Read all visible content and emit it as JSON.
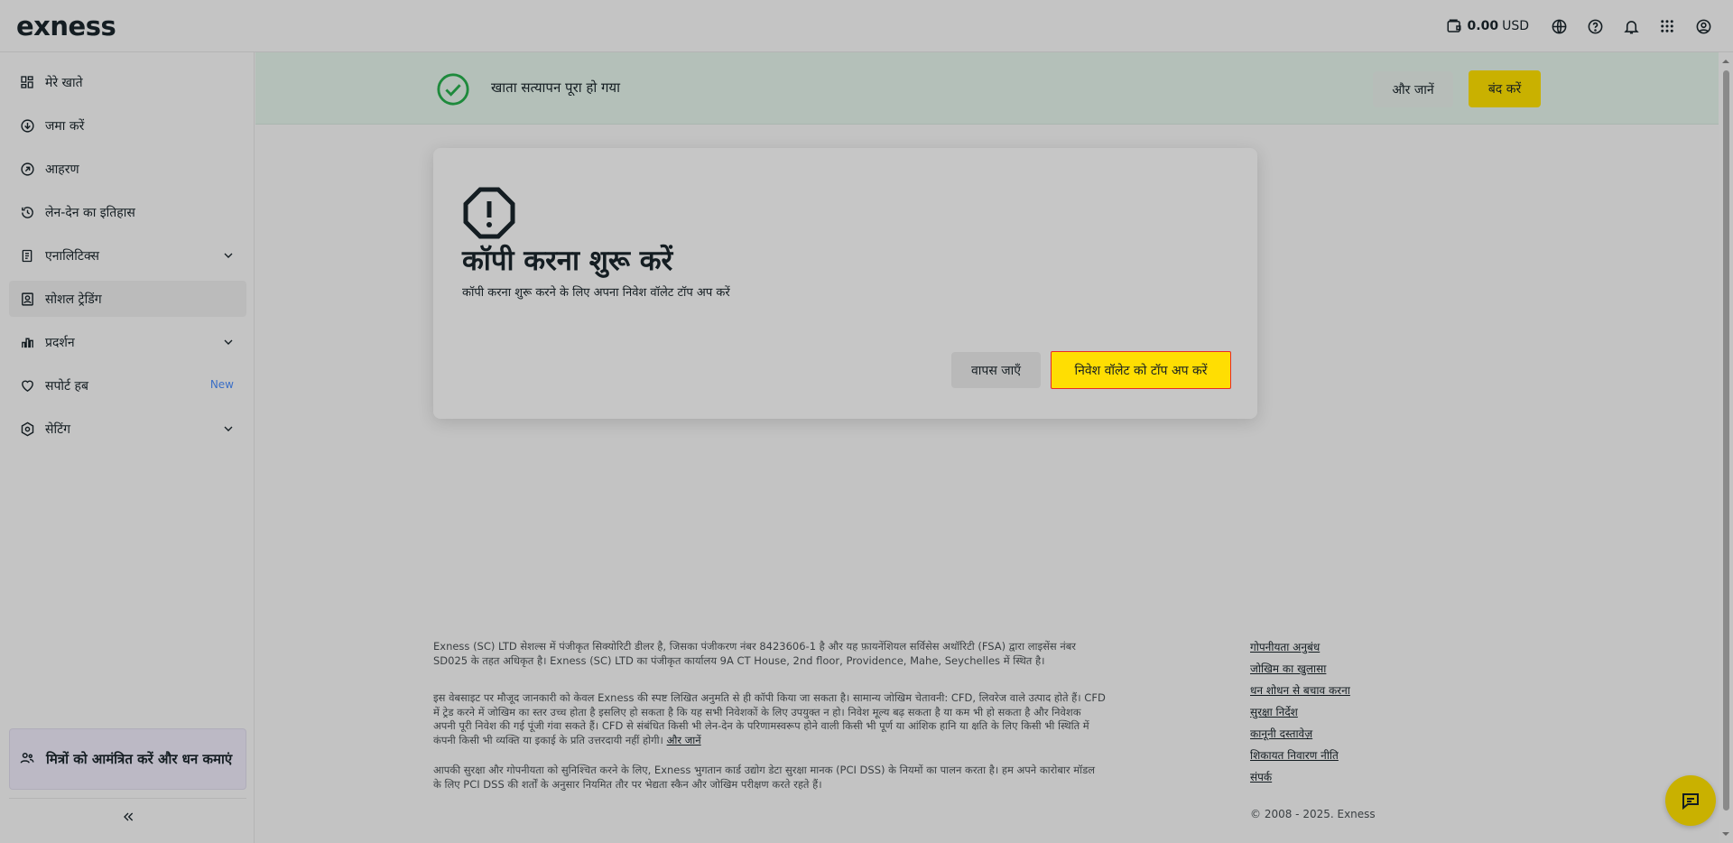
{
  "header": {
    "logo": "exness",
    "balance_amount": "0.00",
    "balance_currency": "USD",
    "icons": [
      "wallet-icon",
      "globe-icon",
      "help-icon",
      "bell-icon",
      "apps-grid-icon",
      "profile-icon"
    ]
  },
  "sidebar": {
    "items": [
      {
        "label": "मेरे खाते",
        "icon": "accounts-grid-icon"
      },
      {
        "label": "जमा करें",
        "icon": "deposit-icon"
      },
      {
        "label": "आहरण",
        "icon": "withdraw-icon"
      },
      {
        "label": "लेन-देन का इतिहास",
        "icon": "history-icon"
      },
      {
        "label": "एनालिटिक्स",
        "icon": "analytics-icon"
      },
      {
        "label": "सोशल ट्रेडिंग",
        "icon": "social-trading-icon"
      },
      {
        "label": "प्रदर्शन",
        "icon": "performance-icon"
      },
      {
        "label": "सपोर्ट हब",
        "icon": "heart-icon",
        "badge": "New"
      },
      {
        "label": "सेटिंग",
        "icon": "settings-icon"
      }
    ],
    "invite": "मित्रों को आमंत्रित करें और धन कमाएं"
  },
  "banner": {
    "message": "खाता सत्यापन पूरा हो गया",
    "learn_more": "और जानें",
    "close": "बंद करें"
  },
  "modal": {
    "title": "कॉपी करना शुरू करें",
    "subtitle": "कॉपी करना शुरू करने के लिए अपना निवेश वॉलेट टॉप अप करें",
    "back": "वापस जाएँ",
    "topup": "निवेश वॉलेट को टॉप अप करें"
  },
  "footer": {
    "legal1": "Exness (SC) LTD सेशल्स में पंजीकृत सिक्योरिटी डीलर है, जिसका पंजीकरण नंबर 8423606-1 है और यह फ़ायनेंशियल सर्विसेस अथॉरिटी (FSA) द्वारा लाइसेंस नंबर SD025 के तहत अधिकृत है। Exness (SC) LTD का पंजीकृत कार्यालय 9A CT House, 2nd floor, Providence, Mahe, Seychelles में स्थित है।",
    "legal2": "इस वेबसाइट पर मौजूद जानकारी को केवल Exness की स्पष्ट लिखित अनुमति से ही कॉपी किया जा सकता है। सामान्य जोखिम चेतावनी: CFD, लिवरेज वाले उत्पाद होते हैं। CFD में ट्रेड करने में जोखिम का स्तर उच्च होता है इसलिए हो सकता है कि यह सभी निवेशकों के लिए उपयुक्त न हो। निवेश मूल्य बढ़ सकता है या कम भी हो सकता है और निवेशक अपनी पूरी निवेश की गई पूंजी गंवा सकते हैं। CFD से संबंधित किसी भी लेन-देन के परिणामस्वरूप होने वाली किसी भी पूर्ण या आंशिक हानि या क्षति के लिए किसी भी स्थिति में कंपनी किसी भी व्यक्ति या इकाई के प्रति उत्तरदायी नहीं होगी।",
    "legal2_more": "और जानें",
    "legal3": "आपकी सुरक्षा और गोपनीयता को सुनिश्चित करने के लिए, Exness भुगतान कार्ड उद्योग डेटा सुरक्षा मानक (PCI DSS) के नियमों का पालन करता है। हम अपने कारोबार मॉडल के लिए PCI DSS की शर्तों के अनुसार नियमित तौर पर भेद्यता स्कैन और जोखिम परीक्षण करते रहते हैं।",
    "links": [
      "गोपनीयता अनुबंध",
      "जोखिम का खुलासा",
      "धन शोधन से बचाव करना",
      "सुरक्षा निर्देश",
      "कानूनी दस्तावेज़",
      "शिकायत निवारण नीति",
      "संपर्क"
    ],
    "copyright": "© 2008 - 2025. Exness"
  },
  "colors": {
    "accent_yellow": "#ffde02",
    "dimmed_yellow": "#c9b100",
    "success_green": "#1e8a3c"
  }
}
